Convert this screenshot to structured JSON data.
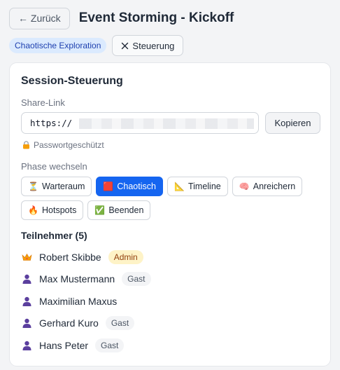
{
  "header": {
    "back_label": "← Zurück",
    "title": "Event Storming - Kickoff"
  },
  "subbar": {
    "phase_badge": "Chaotische Exploration",
    "toggle_label": "Steuerung",
    "toggle_icon": "close-icon"
  },
  "panel": {
    "title": "Session-Steuerung",
    "share_label": "Share-Link",
    "share_value": "https://",
    "copy_label": "Kopieren",
    "password_note": "Passwortgeschützt",
    "phase_label": "Phase wechseln",
    "phases": [
      {
        "emoji": "⏳",
        "label": "Warteraum",
        "active": false
      },
      {
        "emoji": "🟥",
        "label": "Chaotisch",
        "active": true
      },
      {
        "emoji": "📐",
        "label": "Timeline",
        "active": false
      },
      {
        "emoji": "🧠",
        "label": "Anreichern",
        "active": false
      },
      {
        "emoji": "🔥",
        "label": "Hotspots",
        "active": false
      },
      {
        "emoji": "✅",
        "label": "Beenden",
        "active": false
      }
    ],
    "participants_title": "Teilnehmer (5)",
    "participants": [
      {
        "name": "Robert Skibbe",
        "role": "Admin",
        "icon": "crown-icon"
      },
      {
        "name": "Max Mustermann",
        "role": "Gast",
        "icon": "person-icon"
      },
      {
        "name": "Maximilian Maxus",
        "role": "",
        "icon": "person-icon"
      },
      {
        "name": "Gerhard Kuro",
        "role": "Gast",
        "icon": "person-icon"
      },
      {
        "name": "Hans Peter",
        "role": "Gast",
        "icon": "person-icon"
      }
    ]
  },
  "colors": {
    "accent": "#1565f0",
    "admin_badge": "#fef3c7",
    "guest_badge": "#f3f4f6",
    "phase_badge": "#dbeafe"
  }
}
